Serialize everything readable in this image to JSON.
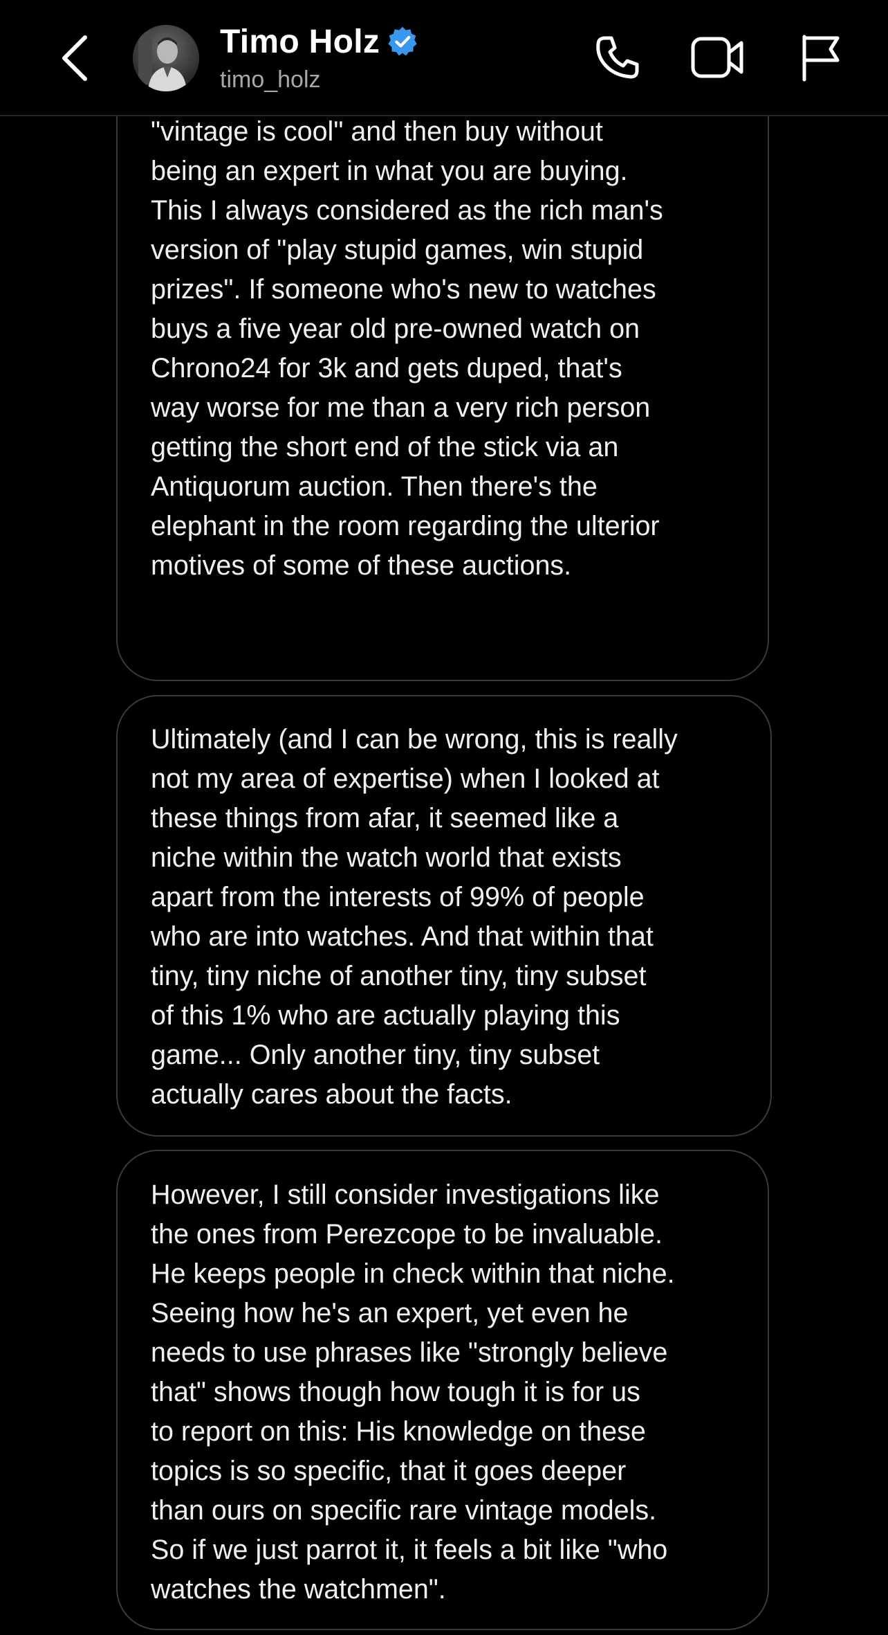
{
  "header": {
    "name": "Timo Holz",
    "username": "timo_holz",
    "verified": true,
    "icons": {
      "back": "chevron-left-icon",
      "call": "phone-icon",
      "video": "video-camera-icon",
      "report": "flag-icon"
    }
  },
  "messages": [
    {
      "text": "down the rabbit hole myself. Imo it doesn't\nwork to have money and the idea that\n\"vintage is cool\" and then buy without\nbeing an expert in what you are buying.\nThis I always considered as the rich man's\nversion of \"play stupid games, win stupid\nprizes\". If someone who's new to watches\nbuys a five year old pre-owned watch on\nChrono24 for 3k and gets duped, that's\nway worse for me than a very rich person\ngetting the short end of the stick via an\nAntiquorum auction. Then there's the\nelephant in the room regarding the ulterior\nmotives of some of these auctions."
    },
    {
      "text": "Ultimately (and I can be wrong, this is really\nnot my area of expertise) when I looked at\nthese things from afar, it seemed like a\nniche within the watch world that exists\napart from the interests of 99% of people\nwho are into watches. And that within that\ntiny, tiny niche of another tiny, tiny subset\nof this 1% who are actually playing this\ngame... Only another tiny, tiny subset\nactually cares about the facts."
    },
    {
      "text": "However, I still consider investigations like\nthe ones from Perezcope to be invaluable.\nHe keeps people in check within that niche.\nSeeing how he's an expert, yet even he\nneeds to use phrases like \"strongly believe\nthat\" shows though how tough it is for us\nto report on this: His knowledge on these\ntopics is so specific, that it goes deeper\nthan ours on specific rare vintage models.\nSo if we just parrot it, it feels a bit like \"who\nwatches the watchmen\"."
    }
  ],
  "colors": {
    "background": "#000000",
    "bubble_border": "#3a3a3a",
    "text": "#f0f0f0",
    "secondary_text": "#a8a8a8",
    "verified_badge": "#3897f0"
  }
}
